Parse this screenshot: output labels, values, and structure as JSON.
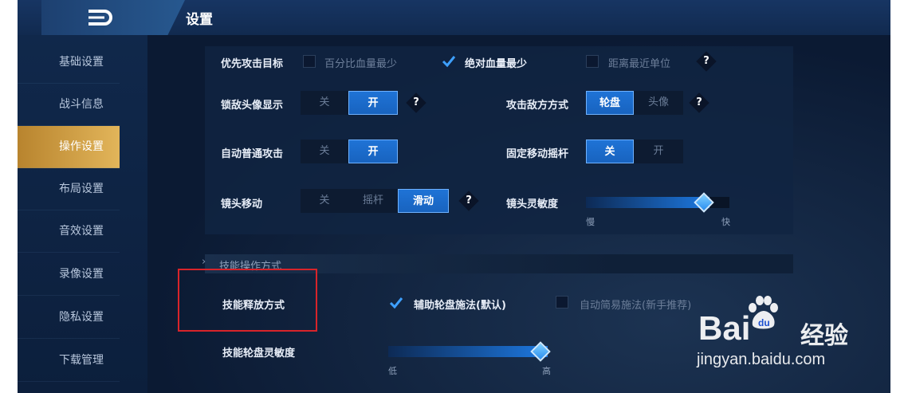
{
  "header": {
    "title": "设置"
  },
  "sidebar": {
    "items": [
      {
        "label": "基础设置",
        "active": false
      },
      {
        "label": "战斗信息",
        "active": false
      },
      {
        "label": "操作设置",
        "active": true
      },
      {
        "label": "布局设置",
        "active": false
      },
      {
        "label": "音效设置",
        "active": false
      },
      {
        "label": "录像设置",
        "active": false
      },
      {
        "label": "隐私设置",
        "active": false
      },
      {
        "label": "下载管理",
        "active": false
      }
    ]
  },
  "settings": {
    "priority": {
      "label": "优先攻击目标",
      "opt1": "百分比血量最少",
      "opt2": "绝对血量最少",
      "opt3": "距离最近单位",
      "help": "?"
    },
    "lock_avatar": {
      "label": "锁敌头像显示",
      "off": "关",
      "on": "开",
      "help": "?"
    },
    "attack_mode": {
      "label": "攻击敌方方式",
      "opt1": "轮盘",
      "opt2": "头像",
      "help": "?"
    },
    "auto_attack": {
      "label": "自动普通攻击",
      "off": "关",
      "on": "开"
    },
    "fixed_joystick": {
      "label": "固定移动摇杆",
      "off": "关",
      "on": "开"
    },
    "camera_move": {
      "label": "镜头移动",
      "opt1": "关",
      "opt2": "摇杆",
      "opt3": "滑动",
      "help": "?"
    },
    "camera_sens": {
      "label": "镜头灵敏度",
      "min": "慢",
      "max": "快",
      "value": 0.86
    }
  },
  "skill": {
    "section": "技能操作方式",
    "release": {
      "label": "技能释放方式",
      "opt1": "辅助轮盘施法(默认)",
      "opt2": "自动简易施法(新手推荐)"
    },
    "wheel_sens": {
      "label": "技能轮盘灵敏度",
      "min": "低",
      "max": "高",
      "value": 1.0
    }
  },
  "watermark": {
    "brand": "Bai",
    "brand_cn": "经验",
    "url": "jingyan.baidu.com"
  },
  "colors": {
    "accent": "#1f73d6",
    "active_tab": "#d9aa50",
    "highlight_box": "#d8242a"
  }
}
